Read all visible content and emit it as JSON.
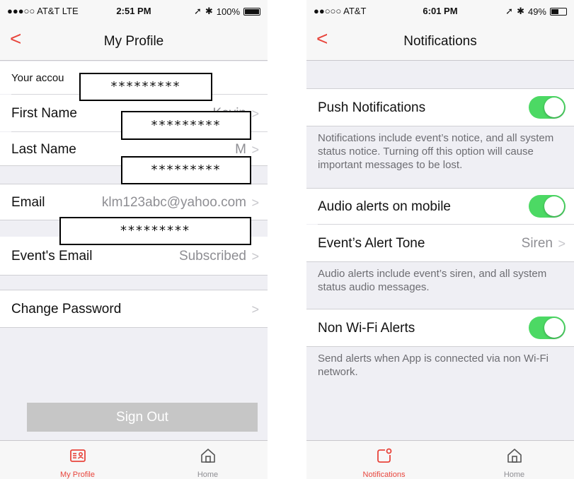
{
  "left": {
    "status": {
      "carrier": "●●●○○ AT&T  LTE",
      "time": "2:51 PM",
      "battery": "100%",
      "battery_level": 1.0
    },
    "title": "My Profile",
    "account_label": "Your accou",
    "masked": "*********",
    "rows": {
      "first_name": {
        "label": "First Name",
        "value": "Kevin"
      },
      "last_name": {
        "label": "Last Name",
        "value": "M"
      },
      "email": {
        "label": "Email",
        "value": "klm123abc@yahoo.com"
      },
      "events_email": {
        "label": "Event's Email",
        "value": "Subscribed"
      },
      "change_password": {
        "label": "Change Password"
      }
    },
    "sign_out": "Sign Out",
    "tabs": [
      {
        "label": "My Profile",
        "icon": "profile-card-icon",
        "active": true
      },
      {
        "label": "Home",
        "icon": "home-icon",
        "active": false
      }
    ]
  },
  "right": {
    "status": {
      "carrier": "●●○○○ AT&T",
      "time": "6:01 PM",
      "battery": "49%",
      "battery_level": 0.49
    },
    "title": "Notifications",
    "push": {
      "label": "Push Notifications",
      "on": true
    },
    "push_desc": "Notifications include event’s notice, and all system status notice. Turning off this option will cause important messages to be lost.",
    "audio": {
      "label": "Audio alerts on mobile",
      "on": true
    },
    "tone": {
      "label": "Event’s Alert Tone",
      "value": "Siren"
    },
    "audio_desc": "Audio alerts include event’s siren, and all system status audio messages.",
    "nonwifi": {
      "label": "Non Wi-Fi Alerts",
      "on": true
    },
    "nonwifi_desc": "Send alerts when App is connected via non Wi-Fi network.",
    "tabs": [
      {
        "label": "Notifications",
        "icon": "notification-icon",
        "active": true
      },
      {
        "label": "Home",
        "icon": "home-icon",
        "active": false
      }
    ]
  },
  "colors": {
    "accent": "#e8453c",
    "toggle_on": "#4cd964",
    "signout_bg": "#c6c6c6"
  }
}
